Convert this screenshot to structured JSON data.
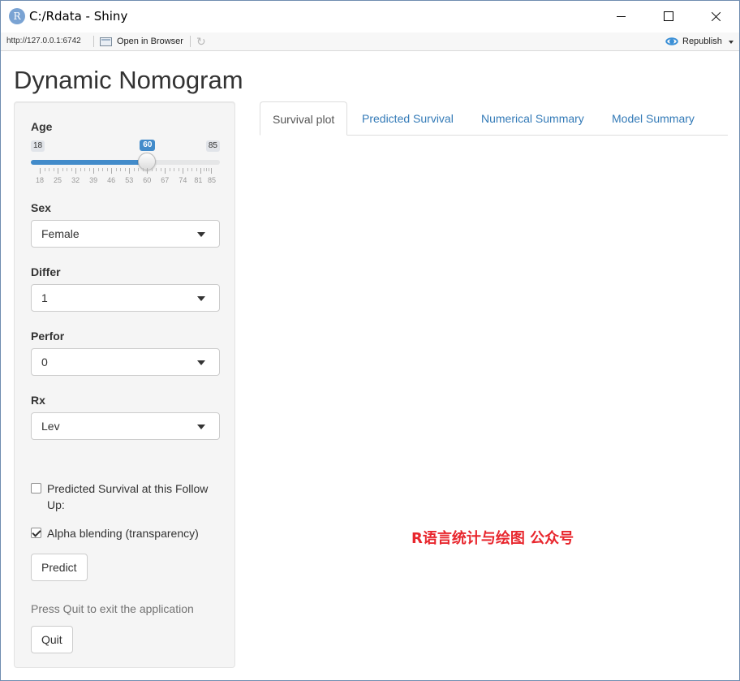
{
  "window": {
    "title": "C:/Rdata - Shiny",
    "app_icon_letter": "R",
    "url": "http://127.0.0.1:6742",
    "open_in_browser": "Open in Browser",
    "republish": "Republish"
  },
  "app": {
    "title": "Dynamic Nomogram"
  },
  "sidebar": {
    "age": {
      "label": "Age",
      "min": 18,
      "max": 85,
      "value": 60,
      "min_label": "18",
      "max_label": "85",
      "value_label": "60",
      "tick_labels": [
        "18",
        "25",
        "32",
        "39",
        "46",
        "53",
        "60",
        "67",
        "74",
        "81",
        "85"
      ]
    },
    "sex": {
      "label": "Sex",
      "value": "Female"
    },
    "differ": {
      "label": "Differ",
      "value": "1"
    },
    "perfor": {
      "label": "Perfor",
      "value": "0"
    },
    "rx": {
      "label": "Rx",
      "value": "Lev"
    },
    "checkbox_followup": {
      "label": "Predicted Survival at this Follow Up:",
      "checked": false
    },
    "checkbox_alpha": {
      "label": "Alpha blending (transparency)",
      "checked": true
    },
    "predict_button": "Predict",
    "quit_help": "Press Quit to exit the application",
    "quit_button": "Quit"
  },
  "tabs": [
    {
      "label": "Survival plot",
      "active": true
    },
    {
      "label": "Predicted Survival",
      "active": false
    },
    {
      "label": "Numerical Summary",
      "active": false
    },
    {
      "label": "Model Summary",
      "active": false
    }
  ],
  "watermark": "R语言统计与绘图 公众号",
  "colors": {
    "accent": "#428bca",
    "link": "#337ab7",
    "watermark": "#e8262d"
  }
}
